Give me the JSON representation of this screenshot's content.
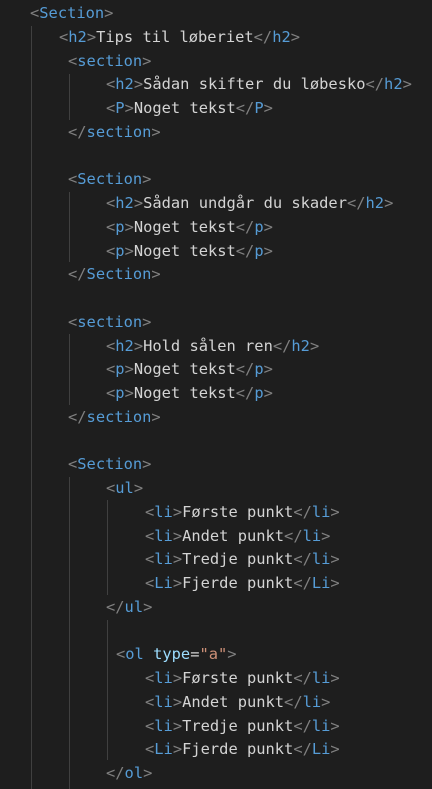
{
  "editor": {
    "language": "html",
    "theme": "dark",
    "colors": {
      "background": "#1e1e1e",
      "bracket": "#808080",
      "tag": "#569cd6",
      "text": "#d4d4d4",
      "attribute": "#9cdcfe",
      "attribute_value": "#ce9178",
      "indent_guide": "#404040"
    },
    "lines": [
      [
        {
          "k": "b",
          "s": "<"
        },
        {
          "k": "t",
          "s": "Section"
        },
        {
          "k": "b",
          "s": ">"
        }
      ],
      [
        {
          "k": "b",
          "s": "<"
        },
        {
          "k": "t",
          "s": "h2"
        },
        {
          "k": "b",
          "s": ">"
        },
        {
          "k": "x",
          "s": "Tips til løberiet"
        },
        {
          "k": "b",
          "s": "</"
        },
        {
          "k": "t",
          "s": "h2"
        },
        {
          "k": "b",
          "s": ">"
        }
      ],
      [
        {
          "k": "b",
          "s": "<"
        },
        {
          "k": "t",
          "s": "section"
        },
        {
          "k": "b",
          "s": ">"
        }
      ],
      [
        {
          "k": "b",
          "s": "<"
        },
        {
          "k": "t",
          "s": "h2"
        },
        {
          "k": "b",
          "s": ">"
        },
        {
          "k": "x",
          "s": "Sådan skifter du løbesko"
        },
        {
          "k": "b",
          "s": "</"
        },
        {
          "k": "t",
          "s": "h2"
        },
        {
          "k": "b",
          "s": ">"
        }
      ],
      [
        {
          "k": "b",
          "s": "<"
        },
        {
          "k": "t",
          "s": "P"
        },
        {
          "k": "b",
          "s": ">"
        },
        {
          "k": "x",
          "s": "Noget tekst"
        },
        {
          "k": "b",
          "s": "</"
        },
        {
          "k": "t",
          "s": "P"
        },
        {
          "k": "b",
          "s": ">"
        }
      ],
      [
        {
          "k": "b",
          "s": "</"
        },
        {
          "k": "t",
          "s": "section"
        },
        {
          "k": "b",
          "s": ">"
        }
      ],
      [],
      [
        {
          "k": "b",
          "s": "<"
        },
        {
          "k": "t",
          "s": "Section"
        },
        {
          "k": "b",
          "s": ">"
        }
      ],
      [
        {
          "k": "b",
          "s": "<"
        },
        {
          "k": "t",
          "s": "h2"
        },
        {
          "k": "b",
          "s": ">"
        },
        {
          "k": "x",
          "s": "Sådan undgår du skader"
        },
        {
          "k": "b",
          "s": "</"
        },
        {
          "k": "t",
          "s": "h2"
        },
        {
          "k": "b",
          "s": ">"
        }
      ],
      [
        {
          "k": "b",
          "s": "<"
        },
        {
          "k": "t",
          "s": "p"
        },
        {
          "k": "b",
          "s": ">"
        },
        {
          "k": "x",
          "s": "Noget tekst"
        },
        {
          "k": "b",
          "s": "</"
        },
        {
          "k": "t",
          "s": "p"
        },
        {
          "k": "b",
          "s": ">"
        }
      ],
      [
        {
          "k": "b",
          "s": "<"
        },
        {
          "k": "t",
          "s": "p"
        },
        {
          "k": "b",
          "s": ">"
        },
        {
          "k": "x",
          "s": "Noget tekst"
        },
        {
          "k": "b",
          "s": "</"
        },
        {
          "k": "t",
          "s": "p"
        },
        {
          "k": "b",
          "s": ">"
        }
      ],
      [
        {
          "k": "b",
          "s": "</"
        },
        {
          "k": "t",
          "s": "Section"
        },
        {
          "k": "b",
          "s": ">"
        }
      ],
      [],
      [
        {
          "k": "b",
          "s": "<"
        },
        {
          "k": "t",
          "s": "section"
        },
        {
          "k": "b",
          "s": ">"
        }
      ],
      [
        {
          "k": "b",
          "s": "<"
        },
        {
          "k": "t",
          "s": "h2"
        },
        {
          "k": "b",
          "s": ">"
        },
        {
          "k": "x",
          "s": "Hold sålen ren"
        },
        {
          "k": "b",
          "s": "</"
        },
        {
          "k": "t",
          "s": "h2"
        },
        {
          "k": "b",
          "s": ">"
        }
      ],
      [
        {
          "k": "b",
          "s": "<"
        },
        {
          "k": "t",
          "s": "p"
        },
        {
          "k": "b",
          "s": ">"
        },
        {
          "k": "x",
          "s": "Noget tekst"
        },
        {
          "k": "b",
          "s": "</"
        },
        {
          "k": "t",
          "s": "p"
        },
        {
          "k": "b",
          "s": ">"
        }
      ],
      [
        {
          "k": "b",
          "s": "<"
        },
        {
          "k": "t",
          "s": "p"
        },
        {
          "k": "b",
          "s": ">"
        },
        {
          "k": "x",
          "s": "Noget tekst"
        },
        {
          "k": "b",
          "s": "</"
        },
        {
          "k": "t",
          "s": "p"
        },
        {
          "k": "b",
          "s": ">"
        }
      ],
      [
        {
          "k": "b",
          "s": "</"
        },
        {
          "k": "t",
          "s": "section"
        },
        {
          "k": "b",
          "s": ">"
        }
      ],
      [],
      [
        {
          "k": "b",
          "s": "<"
        },
        {
          "k": "t",
          "s": "Section"
        },
        {
          "k": "b",
          "s": ">"
        }
      ],
      [
        {
          "k": "b",
          "s": "<"
        },
        {
          "k": "t",
          "s": "ul"
        },
        {
          "k": "b",
          "s": ">"
        }
      ],
      [
        {
          "k": "b",
          "s": "<"
        },
        {
          "k": "t",
          "s": "li"
        },
        {
          "k": "b",
          "s": ">"
        },
        {
          "k": "x",
          "s": "Første punkt"
        },
        {
          "k": "b",
          "s": "</"
        },
        {
          "k": "t",
          "s": "li"
        },
        {
          "k": "b",
          "s": ">"
        }
      ],
      [
        {
          "k": "b",
          "s": "<"
        },
        {
          "k": "t",
          "s": "li"
        },
        {
          "k": "b",
          "s": ">"
        },
        {
          "k": "x",
          "s": "Andet punkt"
        },
        {
          "k": "b",
          "s": "</"
        },
        {
          "k": "t",
          "s": "li"
        },
        {
          "k": "b",
          "s": ">"
        }
      ],
      [
        {
          "k": "b",
          "s": "<"
        },
        {
          "k": "t",
          "s": "li"
        },
        {
          "k": "b",
          "s": ">"
        },
        {
          "k": "x",
          "s": "Tredje punkt"
        },
        {
          "k": "b",
          "s": "</"
        },
        {
          "k": "t",
          "s": "li"
        },
        {
          "k": "b",
          "s": ">"
        }
      ],
      [
        {
          "k": "b",
          "s": "<"
        },
        {
          "k": "t",
          "s": "Li"
        },
        {
          "k": "b",
          "s": ">"
        },
        {
          "k": "x",
          "s": "Fjerde punkt"
        },
        {
          "k": "b",
          "s": "</"
        },
        {
          "k": "t",
          "s": "Li"
        },
        {
          "k": "b",
          "s": ">"
        }
      ],
      [
        {
          "k": "b",
          "s": "</"
        },
        {
          "k": "t",
          "s": "ul"
        },
        {
          "k": "b",
          "s": ">"
        }
      ],
      [],
      [
        {
          "k": "b",
          "s": "<"
        },
        {
          "k": "t",
          "s": "ol"
        },
        {
          "k": "x",
          "s": " "
        },
        {
          "k": "a",
          "s": "type"
        },
        {
          "k": "x",
          "s": "="
        },
        {
          "k": "v",
          "s": "\"a\""
        },
        {
          "k": "b",
          "s": ">"
        }
      ],
      [
        {
          "k": "b",
          "s": "<"
        },
        {
          "k": "t",
          "s": "li"
        },
        {
          "k": "b",
          "s": ">"
        },
        {
          "k": "x",
          "s": "Første punkt"
        },
        {
          "k": "b",
          "s": "</"
        },
        {
          "k": "t",
          "s": "li"
        },
        {
          "k": "b",
          "s": ">"
        }
      ],
      [
        {
          "k": "b",
          "s": "<"
        },
        {
          "k": "t",
          "s": "li"
        },
        {
          "k": "b",
          "s": ">"
        },
        {
          "k": "x",
          "s": "Andet punkt"
        },
        {
          "k": "b",
          "s": "</"
        },
        {
          "k": "t",
          "s": "li"
        },
        {
          "k": "b",
          "s": ">"
        }
      ],
      [
        {
          "k": "b",
          "s": "<"
        },
        {
          "k": "t",
          "s": "li"
        },
        {
          "k": "b",
          "s": ">"
        },
        {
          "k": "x",
          "s": "Tredje punkt"
        },
        {
          "k": "b",
          "s": "</"
        },
        {
          "k": "t",
          "s": "li"
        },
        {
          "k": "b",
          "s": ">"
        }
      ],
      [
        {
          "k": "b",
          "s": "<"
        },
        {
          "k": "t",
          "s": "Li"
        },
        {
          "k": "b",
          "s": ">"
        },
        {
          "k": "x",
          "s": "Fjerde punkt"
        },
        {
          "k": "b",
          "s": "</"
        },
        {
          "k": "t",
          "s": "Li"
        },
        {
          "k": "b",
          "s": ">"
        }
      ],
      [
        {
          "k": "b",
          "s": "</"
        },
        {
          "k": "t",
          "s": "ol"
        },
        {
          "k": "b",
          "s": ">"
        }
      ]
    ]
  }
}
